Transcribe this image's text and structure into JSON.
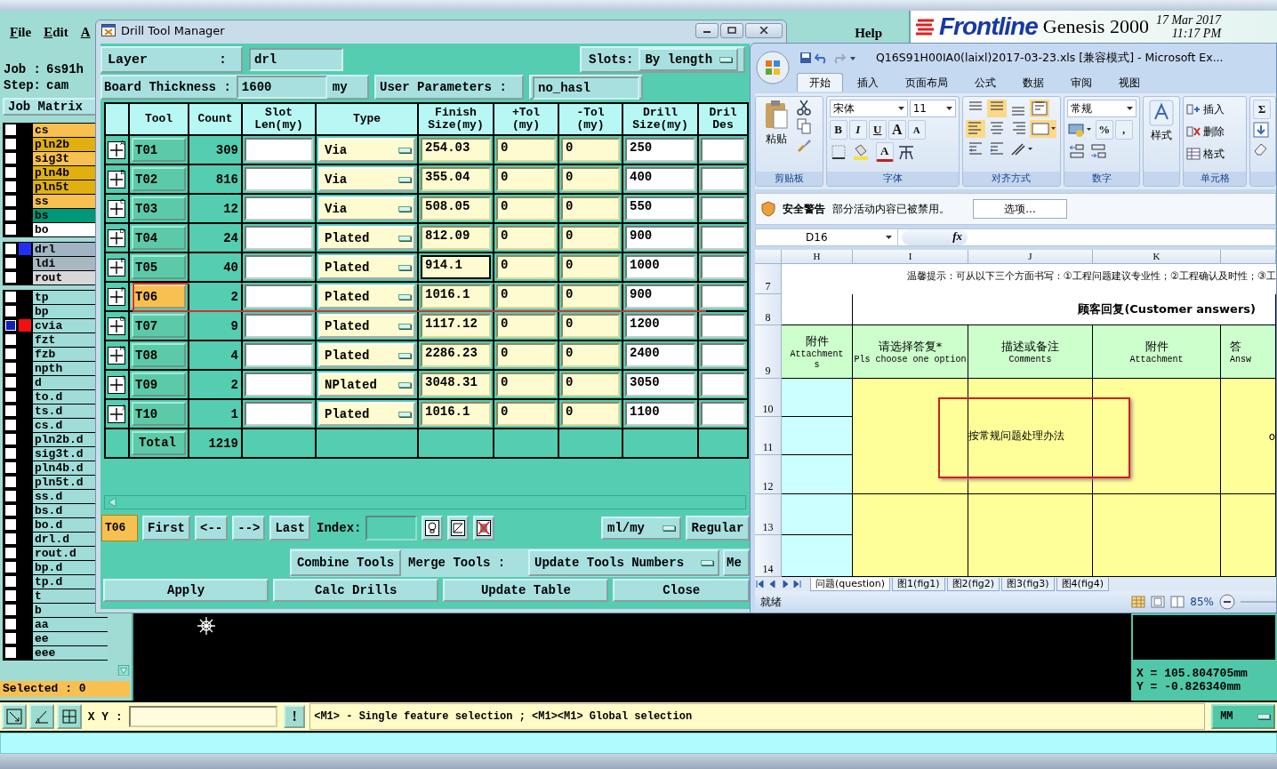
{
  "app": {
    "menu": [
      {
        "label": "File"
      },
      {
        "label": "Edit"
      },
      {
        "label": "A"
      }
    ],
    "help": "Help",
    "brand": "Frontline",
    "product": "Genesis 2000",
    "date": "17 Mar 2017",
    "time": "11:17 PM",
    "job_label": "Job :",
    "job": "6s91h",
    "step_label": "Step:",
    "step": "cam",
    "matrix_button": "Job Matrix",
    "layer_groups": [
      {
        "layers": [
          {
            "name": "cs",
            "color": "#f8c050",
            "checked": false,
            "active": false
          },
          {
            "name": "pln2b",
            "color": "#e0b010",
            "checked": false,
            "active": false
          },
          {
            "name": "sig3t",
            "color": "#f8c050",
            "checked": false,
            "active": false
          },
          {
            "name": "pln4b",
            "color": "#e0b010",
            "checked": false,
            "active": false
          },
          {
            "name": "pln5t",
            "color": "#e0b010",
            "checked": false,
            "active": false
          },
          {
            "name": "ss",
            "color": "#f8c050",
            "checked": false,
            "active": false
          },
          {
            "name": "bs",
            "color": "#009878",
            "checked": false,
            "active": false
          },
          {
            "name": "bo",
            "color": "#ffffff",
            "checked": false,
            "active": false
          }
        ]
      },
      {
        "layers": [
          {
            "name": "drl",
            "color": "#a0b4c4",
            "swatch": {
              "color": "#2030f0"
            },
            "checked": false,
            "active": false
          },
          {
            "name": "ldi",
            "color": "#a8b8c0",
            "checked": false,
            "active": false
          },
          {
            "name": "rout",
            "color": "#d8d8d8",
            "checked": false,
            "active": false
          }
        ]
      },
      {
        "layers": [
          {
            "name": "tp",
            "color": "#a0dcd8",
            "checked": false,
            "active": false
          },
          {
            "name": "bp",
            "color": "#a0dcd8",
            "checked": false,
            "active": false
          },
          {
            "name": "cvia",
            "color": "#a0dcd8",
            "swatch": {
              "color": "#f01010"
            },
            "checked": false,
            "active": true
          },
          {
            "name": "fzt",
            "color": "#a0dcd8",
            "checked": false,
            "active": false
          },
          {
            "name": "fzb",
            "color": "#a0dcd8",
            "checked": false,
            "active": false
          },
          {
            "name": "npth",
            "color": "#a0dcd8",
            "checked": false,
            "active": false
          },
          {
            "name": "d",
            "color": "#a0dcd8",
            "checked": false,
            "active": false
          },
          {
            "name": "to.d",
            "color": "#a0dcd8",
            "checked": false,
            "active": false
          },
          {
            "name": "ts.d",
            "color": "#a0dcd8",
            "checked": false,
            "active": false
          },
          {
            "name": "cs.d",
            "color": "#a0dcd8",
            "checked": false,
            "active": false
          },
          {
            "name": "pln2b.d",
            "color": "#a0dcd8",
            "checked": false,
            "active": false
          },
          {
            "name": "sig3t.d",
            "color": "#a0dcd8",
            "checked": false,
            "active": false
          },
          {
            "name": "pln4b.d",
            "color": "#a0dcd8",
            "checked": false,
            "active": false
          },
          {
            "name": "pln5t.d",
            "color": "#a0dcd8",
            "checked": false,
            "active": false
          },
          {
            "name": "ss.d",
            "color": "#a0dcd8",
            "checked": false,
            "active": false
          },
          {
            "name": "bs.d",
            "color": "#a0dcd8",
            "checked": false,
            "active": false
          },
          {
            "name": "bo.d",
            "color": "#a0dcd8",
            "checked": false,
            "active": false
          },
          {
            "name": "drl.d",
            "color": "#a0dcd8",
            "checked": false,
            "active": false
          },
          {
            "name": "rout.d",
            "color": "#a0dcd8",
            "checked": false,
            "active": false
          },
          {
            "name": "bp.d",
            "color": "#a0dcd8",
            "checked": false,
            "active": false
          },
          {
            "name": "tp.d",
            "color": "#a0dcd8",
            "checked": false,
            "active": false
          },
          {
            "name": "t",
            "color": "#a0dcd8",
            "checked": false,
            "active": false
          },
          {
            "name": "b",
            "color": "#a0dcd8",
            "checked": false,
            "active": false
          },
          {
            "name": "aa",
            "color": "#a0dcd8",
            "checked": false,
            "active": false
          },
          {
            "name": "ee",
            "color": "#a0dcd8",
            "checked": false,
            "active": false
          },
          {
            "name": "eee",
            "color": "#a0dcd8",
            "checked": false,
            "active": false
          }
        ]
      }
    ],
    "selected": "Selected : 0",
    "coords": {
      "x": "X = 105.804705mm",
      "y": "Y = -0.826340mm"
    },
    "xy_label": "X Y :",
    "alert": "!",
    "message": "<M1> - Single feature selection ; <M1><M1> Global selection",
    "units": "MM"
  },
  "drill_tool_manager": {
    "title": "Drill Tool Manager",
    "layer_label": "Layer",
    "layer_colon": ":",
    "layer": "drl",
    "slots_label": "Slots:",
    "slots": "By length",
    "thickness_label": "Board Thickness :",
    "thickness": "1600",
    "thickness_unit": "my",
    "user_params_label": "User Parameters :",
    "user_params": "no_hasl",
    "table": {
      "columns": [
        "Tool",
        "Count",
        "Slot\nLen(my)",
        "Type",
        "Finish\nSize(my)",
        "+Tol\n(my)",
        "-Tol\n(my)",
        "Drill\nSize(my)",
        "Dril\nDes"
      ],
      "rows": [
        {
          "mark": "A",
          "tool": "T01",
          "count": "309",
          "type": "Via",
          "finish": "254.03",
          "plus_tol": "0",
          "minus_tol": "0",
          "drill": "250",
          "selected": false,
          "focused": false,
          "outlined": false
        },
        {
          "mark": "B",
          "tool": "T02",
          "count": "816",
          "type": "Via",
          "finish": "355.04",
          "plus_tol": "0",
          "minus_tol": "0",
          "drill": "400",
          "selected": false,
          "focused": false,
          "outlined": false
        },
        {
          "mark": "C",
          "tool": "T03",
          "count": "12",
          "type": "Via",
          "finish": "508.05",
          "plus_tol": "0",
          "minus_tol": "0",
          "drill": "550",
          "selected": false,
          "focused": false,
          "outlined": false
        },
        {
          "mark": "D",
          "tool": "T04",
          "count": "24",
          "type": "Plated",
          "finish": "812.09",
          "plus_tol": "0",
          "minus_tol": "0",
          "drill": "900",
          "selected": false,
          "focused": false,
          "outlined": false
        },
        {
          "mark": "E",
          "tool": "T05",
          "count": "40",
          "type": "Plated",
          "finish": "914.1",
          "plus_tol": "0",
          "minus_tol": "0",
          "drill": "1000",
          "selected": false,
          "focused": true,
          "outlined": false
        },
        {
          "mark": "F",
          "tool": "T06",
          "count": "2",
          "type": "Plated",
          "finish": "1016.1",
          "plus_tol": "0",
          "minus_tol": "0",
          "drill": "900",
          "selected": true,
          "focused": false,
          "outlined": true
        },
        {
          "mark": "G",
          "tool": "T07",
          "count": "9",
          "type": "Plated",
          "finish": "1117.12",
          "plus_tol": "0",
          "minus_tol": "0",
          "drill": "1200",
          "selected": false,
          "focused": false,
          "outlined": false
        },
        {
          "mark": "H",
          "tool": "T08",
          "count": "4",
          "type": "Plated",
          "finish": "2286.23",
          "plus_tol": "0",
          "minus_tol": "0",
          "drill": "2400",
          "selected": false,
          "focused": false,
          "outlined": false
        },
        {
          "mark": "I",
          "tool": "T09",
          "count": "2",
          "type": "NPlated",
          "finish": "3048.31",
          "plus_tol": "0",
          "minus_tol": "0",
          "drill": "3050",
          "selected": false,
          "focused": false,
          "outlined": false
        },
        {
          "mark": "J",
          "tool": "T10",
          "count": "1",
          "type": "Plated",
          "finish": "1016.1",
          "plus_tol": "0",
          "minus_tol": "0",
          "drill": "1100",
          "selected": false,
          "focused": false,
          "outlined": false
        }
      ],
      "total_label": "Total",
      "total": "1219"
    },
    "current": "T06",
    "nav": [
      "First",
      "<--",
      "-->",
      "Last"
    ],
    "index_label": "Index:",
    "units": "ml/my",
    "mode": "Regular",
    "combine": "Combine Tools",
    "merge_label": "Merge Tools :",
    "merge_option": "Update Tools Numbers",
    "more": "Me",
    "actions": [
      "Apply",
      "Calc Drills",
      "Update Table",
      "Close"
    ]
  },
  "excel": {
    "title": "Q16S91H00IA0(laixl)2017-03-23.xls  [兼容模式] - Microsoft Ex...",
    "tabs": [
      {
        "label": "开始",
        "selected": true
      },
      {
        "label": "插入",
        "selected": false
      },
      {
        "label": "页面布局",
        "selected": false
      },
      {
        "label": "公式",
        "selected": false
      },
      {
        "label": "数据",
        "selected": false
      },
      {
        "label": "审阅",
        "selected": false
      },
      {
        "label": "视图",
        "selected": false
      }
    ],
    "ribbon": {
      "paste": "粘贴",
      "clipboard_label": "剪贴板",
      "font": "宋体",
      "size": "11",
      "font_styles": [
        "B",
        "I",
        "U"
      ],
      "grow": "A",
      "shrink": "A",
      "font_color": "A",
      "font_label": "字体",
      "align_label": "对齐方式",
      "number_format": "常规",
      "percent": "%",
      "comma": ",",
      "number_label": "数字",
      "styles": "样式",
      "cells": [
        "插入",
        "删除",
        "格式"
      ],
      "cells_label": "单元格",
      "sum": "Σ"
    },
    "security": {
      "title": "安全警告",
      "message": "部分活动内容已被禁用。",
      "button": "选项..."
    },
    "name_box": "D16",
    "fx": "fx",
    "sheet": {
      "columns": [
        "H",
        "I",
        "J",
        "K"
      ],
      "rows": [
        "7",
        "8",
        "9",
        "10",
        "11",
        "12",
        "13",
        "14"
      ],
      "note": "温馨提示：可从以下三个方面书写：①工程问题建议专业性；②工程确认及时性；③工",
      "section": "顾客回复(Customer answers)",
      "headers": [
        {
          "zh": "附件",
          "en": "Attachment\ns"
        },
        {
          "zh": "请选择答复*",
          "en": "Pls choose one option"
        },
        {
          "zh": "描述或备注",
          "en": "Comments"
        },
        {
          "zh": "附件",
          "en": "Attachment"
        },
        {
          "zh": "答",
          "en": "Answ"
        }
      ],
      "comment": "按常规问题处理办法",
      "answer": "o",
      "outlined": true
    },
    "sheet_tabs": [
      {
        "label": "问题(question)",
        "selected": true
      },
      {
        "label": "图1(fig1)",
        "selected": false
      },
      {
        "label": "图2(fig2)",
        "selected": false
      },
      {
        "label": "图3(fig3)",
        "selected": false
      },
      {
        "label": "图4(fig4)",
        "selected": false
      }
    ],
    "status": "就绪",
    "zoom": "85%"
  }
}
